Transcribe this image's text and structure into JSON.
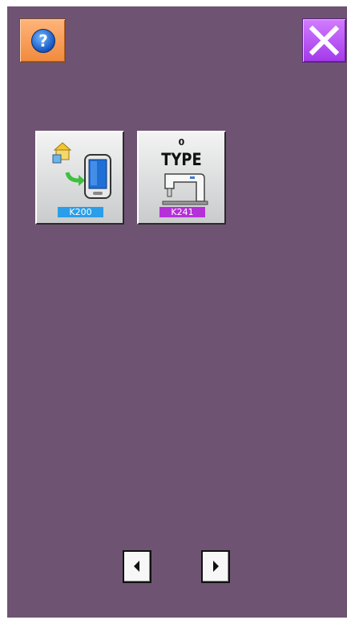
{
  "toolbar": {
    "help_glyph": "?",
    "help_icon": "question-circle-icon",
    "close_icon": "close-x-icon"
  },
  "functions": [
    {
      "name": "communication",
      "icon": "data-transfer-icon",
      "code": "K200",
      "code_color": "#2a9ee8"
    },
    {
      "name": "machine-type",
      "icon": "sewing-machine-icon",
      "value": "0",
      "title": "TYPE",
      "code": "K241",
      "code_color": "#b530d9"
    }
  ],
  "navigation": {
    "prev_icon": "triangle-left-icon",
    "next_icon": "triangle-right-icon"
  },
  "colors": {
    "background": "#6f5373",
    "help_button": "#f08a3c",
    "close_button": "#a339ea"
  }
}
